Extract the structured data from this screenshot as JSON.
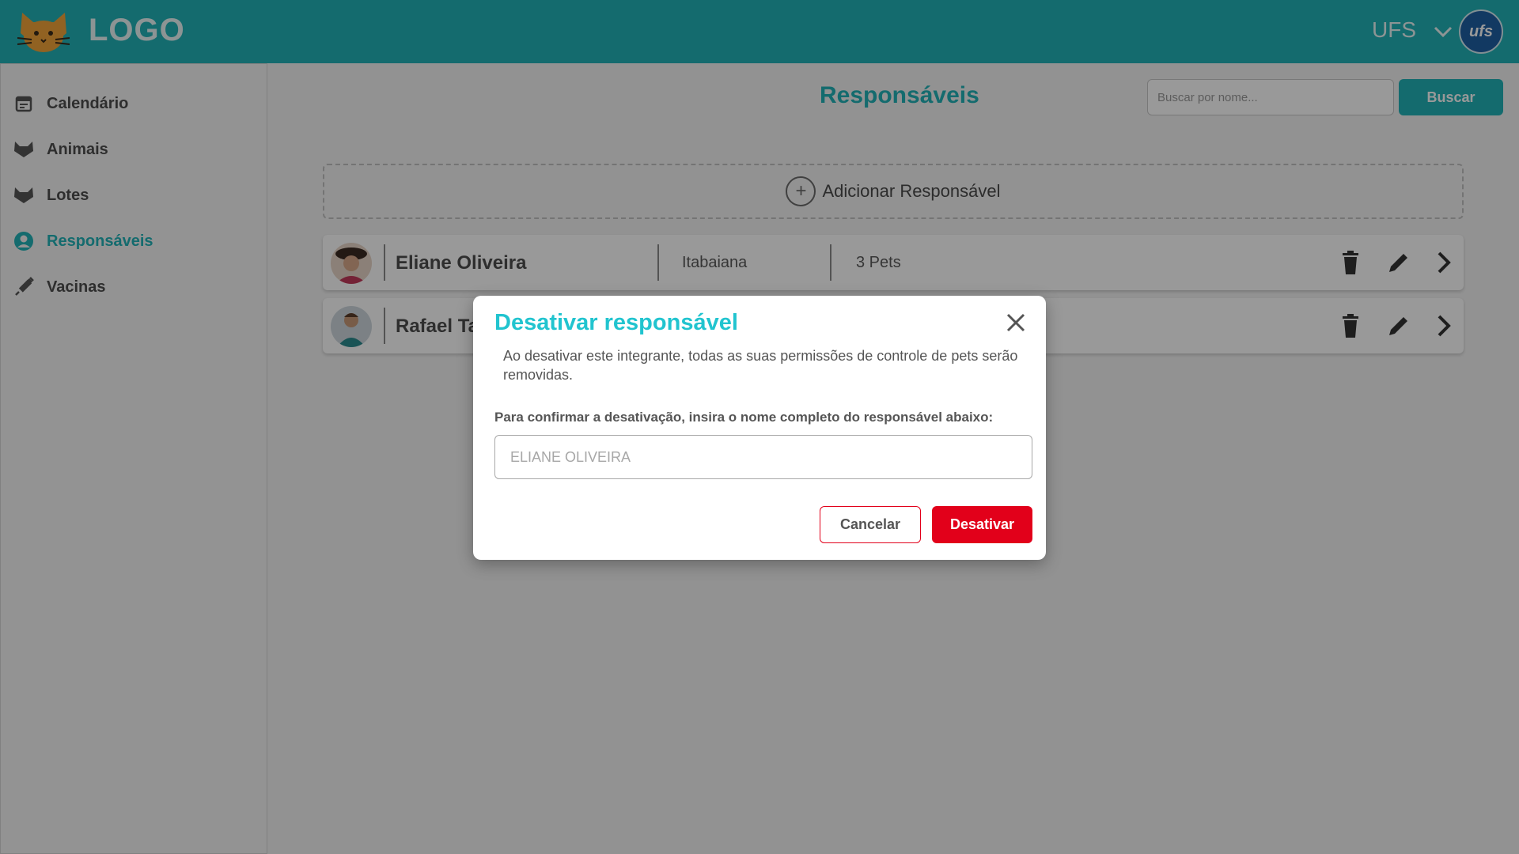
{
  "header": {
    "logo_text": "LOGO",
    "org_label": "UFS",
    "org_avatar_text": "ufs"
  },
  "sidebar": {
    "items": [
      {
        "label": "Calendário",
        "icon": "calendar-icon"
      },
      {
        "label": "Animais",
        "icon": "cat-icon"
      },
      {
        "label": "Lotes",
        "icon": "cat-icon"
      },
      {
        "label": "Responsáveis",
        "icon": "user-circle-icon",
        "active": true
      },
      {
        "label": "Vacinas",
        "icon": "syringe-icon"
      }
    ]
  },
  "main": {
    "title": "Responsáveis",
    "search": {
      "placeholder": "Buscar por nome...",
      "button_label": "Buscar"
    },
    "add_label": "Adicionar Responsável",
    "rows": [
      {
        "name": "Eliane Oliveira",
        "city": "Itabaiana",
        "pets": "3 Pets"
      },
      {
        "name": "Rafael Tavares",
        "city": "",
        "pets": ""
      }
    ]
  },
  "modal": {
    "title": "Desativar responsável",
    "description": "Ao desativar este integrante, todas as suas permissões de controle de pets serão removidas.",
    "confirm_label": "Para confirmar a desativação, insira o nome completo do responsável abaixo:",
    "input_placeholder": "ELIANE OLIVEIRA",
    "cancel_label": "Cancelar",
    "confirm_button_label": "Desativar"
  },
  "colors": {
    "brand": "#22b3b7",
    "modal_title": "#21c4cf",
    "danger": "#e2001a"
  }
}
